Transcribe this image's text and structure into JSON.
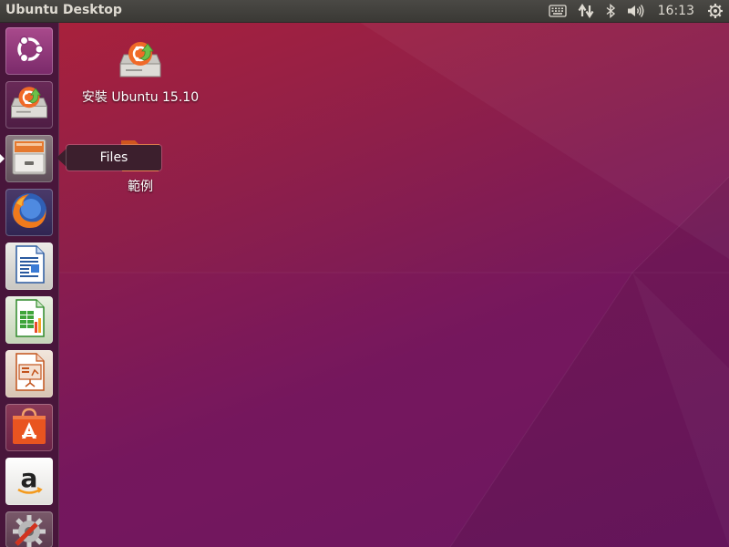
{
  "top_panel": {
    "title": "Ubuntu Desktop",
    "clock": "16:13",
    "indicators": [
      "keyboard-icon",
      "network-icon",
      "bluetooth-icon",
      "volume-icon",
      "session-gear-icon"
    ]
  },
  "launcher": {
    "items": [
      {
        "name": "Ubuntu Dash",
        "icon": "ubuntu-logo-icon"
      },
      {
        "name": "Install Ubuntu",
        "icon": "installer-icon"
      },
      {
        "name": "Files",
        "icon": "file-cabinet-icon",
        "active": true
      },
      {
        "name": "Firefox",
        "icon": "firefox-icon"
      },
      {
        "name": "LibreOffice Writer",
        "icon": "writer-icon"
      },
      {
        "name": "LibreOffice Calc",
        "icon": "calc-icon"
      },
      {
        "name": "LibreOffice Impress",
        "icon": "impress-icon"
      },
      {
        "name": "Ubuntu Software",
        "icon": "software-center-icon"
      },
      {
        "name": "Amazon",
        "icon": "amazon-icon"
      },
      {
        "name": "System Settings",
        "icon": "settings-icon"
      }
    ]
  },
  "tooltip": {
    "label": "Files"
  },
  "desktop": {
    "icons": [
      {
        "label": "安裝 Ubuntu 15.10",
        "icon": "installer-icon"
      },
      {
        "label": "範例",
        "icon": "folder-icon"
      }
    ]
  },
  "colors": {
    "panel": "#3c3b37",
    "launcher": "#46163a",
    "desktop_top": "#a8213c",
    "desktop_bottom": "#6a1760",
    "ubuntu_orange": "#e95420"
  }
}
